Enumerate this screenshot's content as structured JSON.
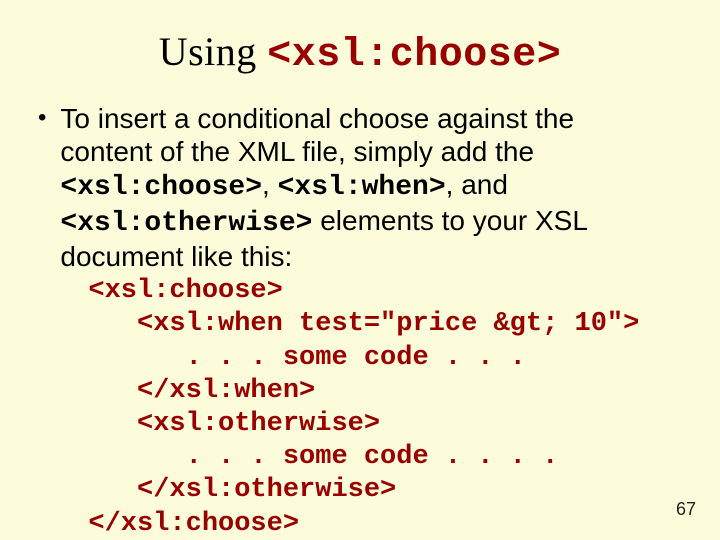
{
  "title": {
    "plain": "Using ",
    "code": "<xsl:choose>"
  },
  "bullet": "•",
  "intro": {
    "part1": "To insert a conditional choose against the content of the XML file, simply add the ",
    "code1": "<xsl:choose>",
    "sep1": ", ",
    "code2": "<xsl:when>",
    "sep2": ", and ",
    "code3": "<xsl:otherwise>",
    "part2": " elements to your XSL document like this:"
  },
  "code": "<xsl:choose>\n   <xsl:when test=\"price &gt; 10\">\n      . . . some code . . .\n   </xsl:when>\n   <xsl:otherwise>\n      . . . some code . . . .\n   </xsl:otherwise>\n</xsl:choose>",
  "page_number": "67"
}
